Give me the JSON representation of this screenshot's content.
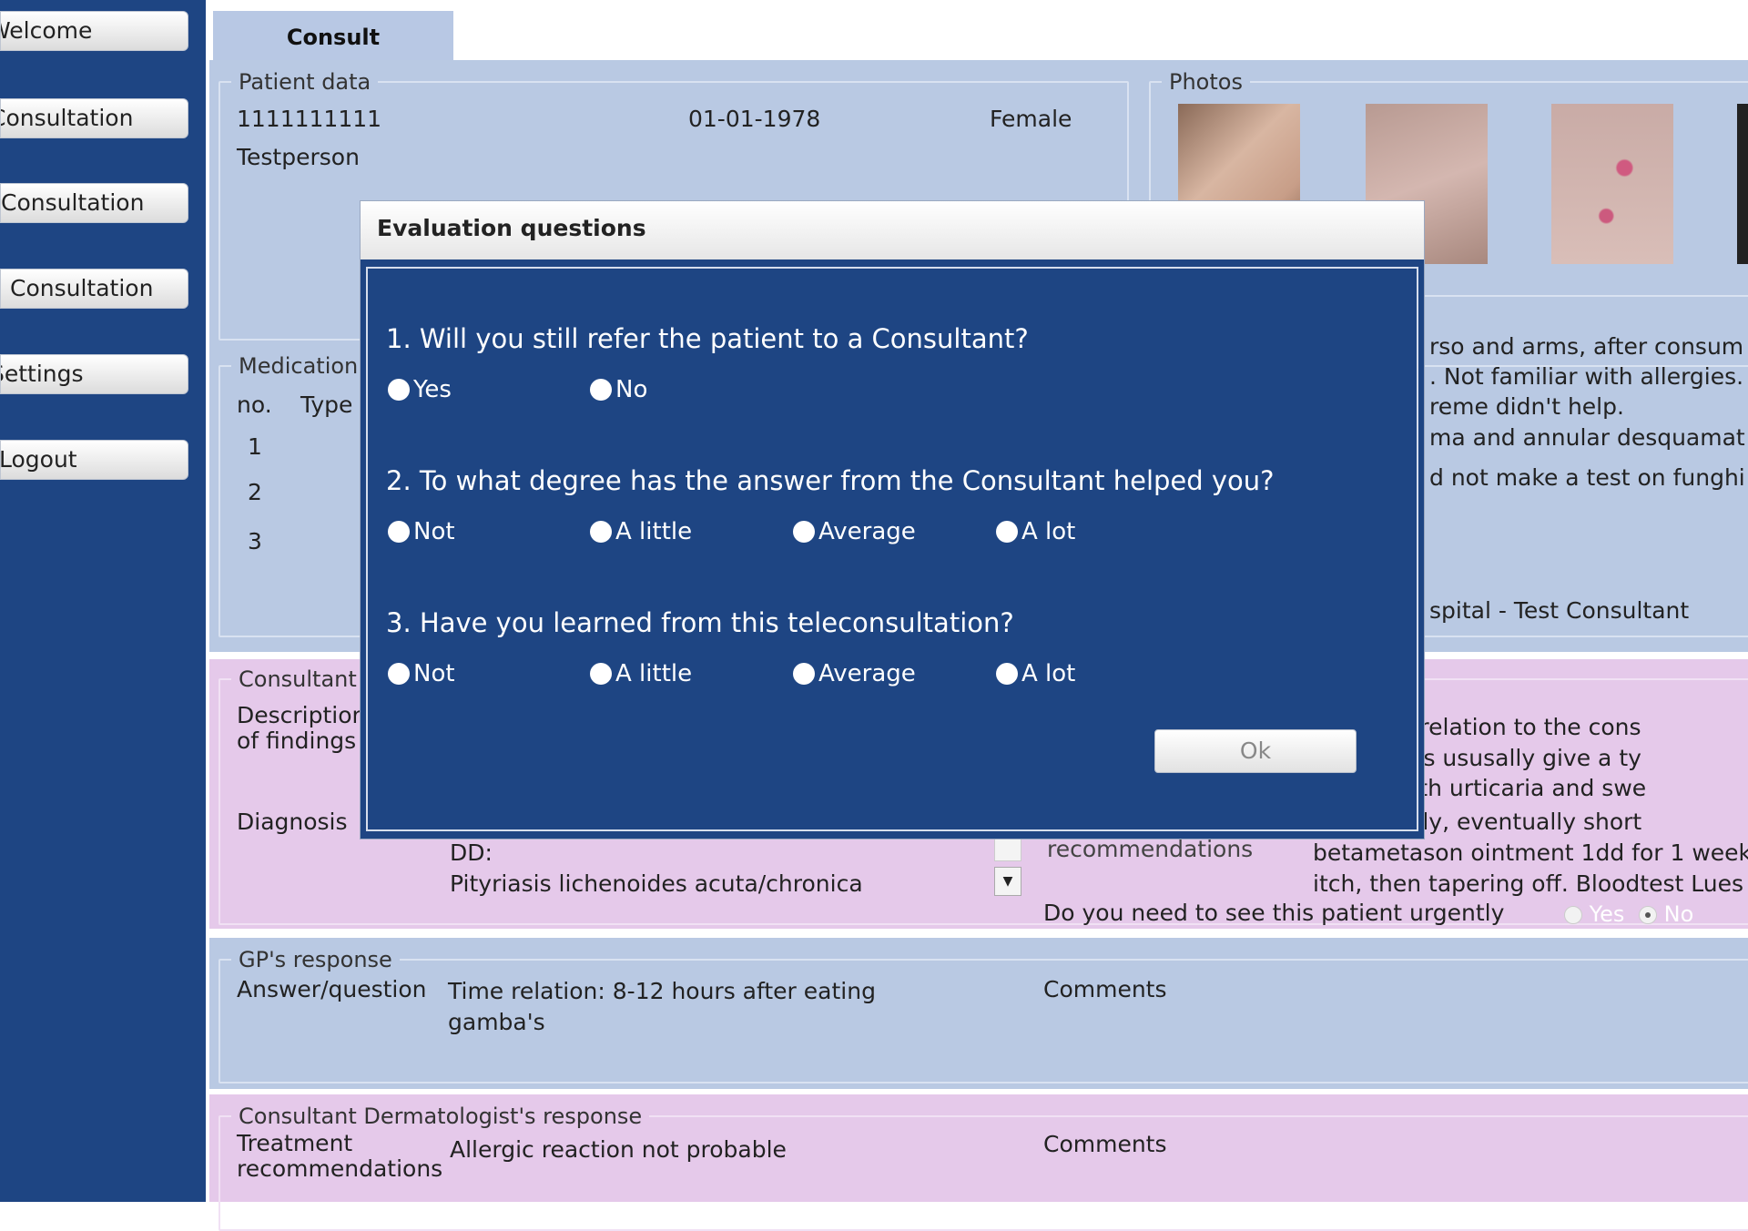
{
  "sidebar": {
    "items": [
      {
        "label": "Welcome"
      },
      {
        "label": "Consultation"
      },
      {
        "label": "Consultation"
      },
      {
        "label": "Consultation"
      },
      {
        "label": "Settings"
      },
      {
        "label": "Logout"
      }
    ]
  },
  "tabs": [
    {
      "label": "Consult"
    }
  ],
  "patient_data": {
    "legend": "Patient data",
    "id": "1111111111",
    "dob": "01-01-1978",
    "sex": "Female",
    "name": "Testperson"
  },
  "photos": {
    "legend": "Photos"
  },
  "medication": {
    "legend": "Medication",
    "col_no": "no.",
    "col_type": "Type",
    "rows": [
      "1",
      "2",
      "3"
    ]
  },
  "history": {
    "lines": [
      "rso and arms, after consum",
      ". Not familiar with allergies.",
      "reme didn't help.",
      "ma and annular desquamat",
      "d not make a test on funghi"
    ],
    "hospital": "spital - Test Consultant"
  },
  "consultant": {
    "legend": "Consultant",
    "description_label": "Description of findings",
    "diagnosis_label": "Diagnosis",
    "right_lines": [
      "the time relation to the cons",
      "s (gambas ususally give a ty",
      "action with urticaria and swe",
      "ntaneously, eventually short",
      "betametason ointment 1dd for 1 week",
      "itch, then tapering off. Bloodtest Lues"
    ],
    "dd_label": "DD:",
    "dd_value": "Pityriasis lichenoides acuta/chronica",
    "recommendations_label": "recommendations",
    "urgent_question": "Do you need to see this patient urgently",
    "urgent_yes": "Yes",
    "urgent_no": "No"
  },
  "gp_response": {
    "legend": "GP's response",
    "answer_label": "Answer/question",
    "answer_value": "Time relation: 8-12 hours after eating gamba's",
    "comments_label": "Comments"
  },
  "derm_response": {
    "legend": "Consultant Dermatologist's response",
    "treatment_label": "Treatment recommendations",
    "treatment_value": "Allergic reaction not probable",
    "comments_label": "Comments"
  },
  "modal": {
    "title": "Evaluation questions",
    "questions": [
      {
        "text": "1. Will you still refer the patient to a Consultant?",
        "options": [
          "Yes",
          "No"
        ]
      },
      {
        "text": "2. To what degree has the answer from the Consultant helped you?",
        "options": [
          "Not",
          "A little",
          "Average",
          "A lot"
        ]
      },
      {
        "text": "3. Have you learned from this teleconsultation?",
        "options": [
          "Not",
          "A little",
          "Average",
          "A lot"
        ]
      }
    ],
    "ok_label": "Ok"
  },
  "colors": {
    "sidebar": "#1e4583",
    "panel_blue": "#b9c9e3",
    "panel_pink": "#e5c9ea",
    "modal_bg": "#1e4583"
  }
}
